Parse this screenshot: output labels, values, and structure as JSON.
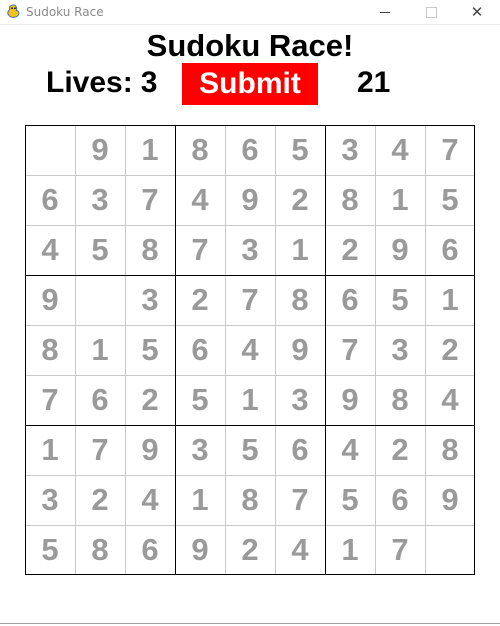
{
  "window": {
    "title": "Sudoku Race",
    "close_glyph": "✕"
  },
  "game": {
    "title": "Sudoku Race!",
    "lives_label": "Lives:",
    "lives_value": "3",
    "submit_label": "Submit",
    "timer_value": "21"
  },
  "board": {
    "rows": [
      [
        "",
        "9",
        "1",
        "8",
        "6",
        "5",
        "3",
        "4",
        "7"
      ],
      [
        "6",
        "3",
        "7",
        "4",
        "9",
        "2",
        "8",
        "1",
        "5"
      ],
      [
        "4",
        "5",
        "8",
        "7",
        "3",
        "1",
        "2",
        "9",
        "6"
      ],
      [
        "9",
        "",
        "3",
        "2",
        "7",
        "8",
        "6",
        "5",
        "1"
      ],
      [
        "8",
        "1",
        "5",
        "6",
        "4",
        "9",
        "7",
        "3",
        "2"
      ],
      [
        "7",
        "6",
        "2",
        "5",
        "1",
        "3",
        "9",
        "8",
        "4"
      ],
      [
        "1",
        "7",
        "9",
        "3",
        "5",
        "6",
        "4",
        "2",
        "8"
      ],
      [
        "3",
        "2",
        "4",
        "1",
        "8",
        "7",
        "5",
        "6",
        "9"
      ],
      [
        "5",
        "8",
        "6",
        "9",
        "2",
        "4",
        "1",
        "7",
        ""
      ]
    ]
  },
  "colors": {
    "submit_bg": "#ff0000",
    "digit": "#9a9a9a",
    "thin_line": "#c8c8c8",
    "thick_line": "#000000"
  }
}
